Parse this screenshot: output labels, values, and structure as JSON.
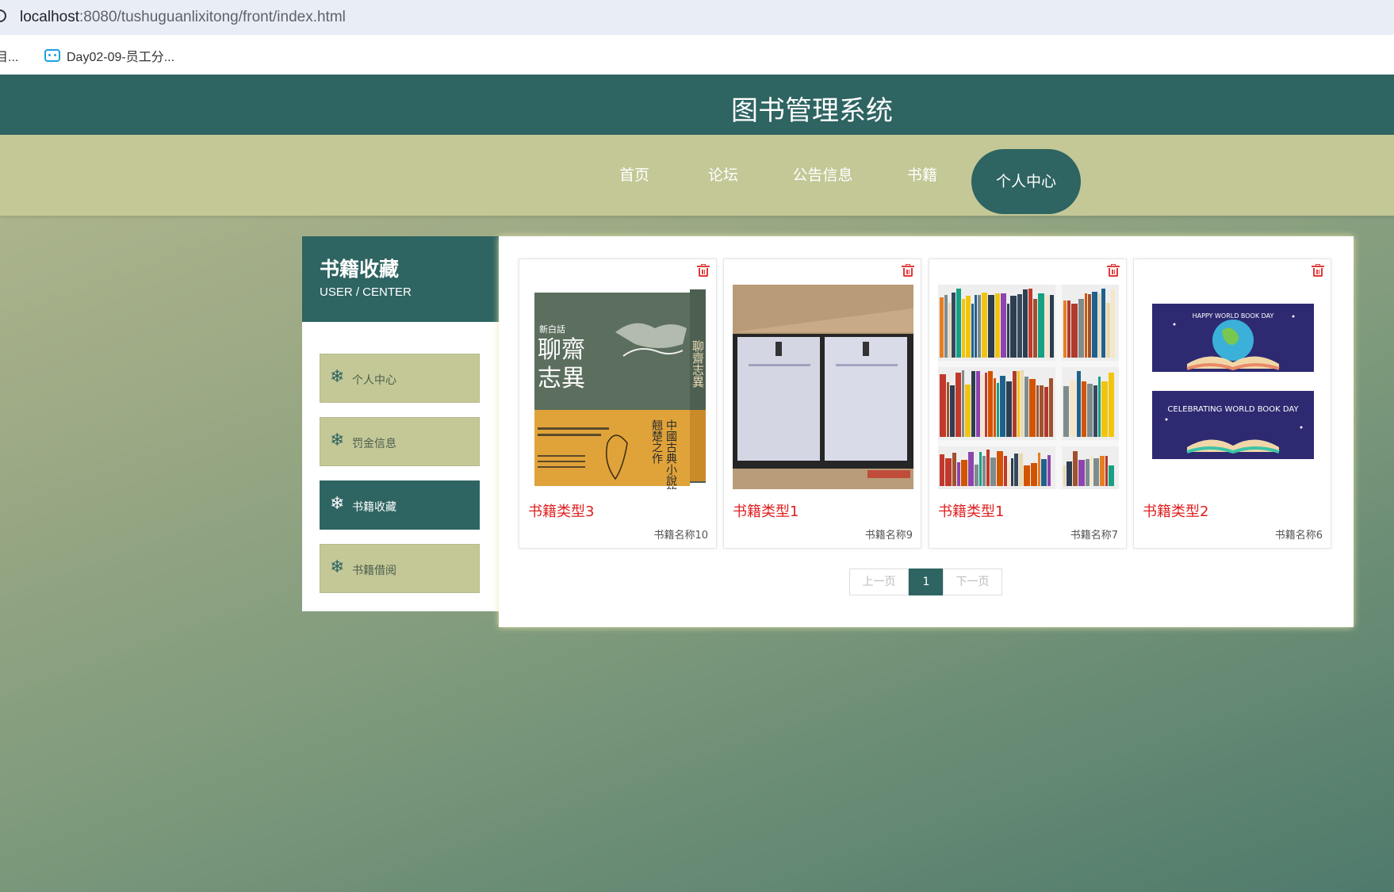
{
  "browser": {
    "url_host": "localhost",
    "url_rest": ":8080/tushuguanlixitong/front/index.html",
    "bookmark_partial": "目...",
    "bookmark_item": "Day02-09-员工分..."
  },
  "header": {
    "title": "图书管理系统"
  },
  "nav": {
    "items": [
      {
        "label": "首页"
      },
      {
        "label": "论坛"
      },
      {
        "label": "公告信息"
      },
      {
        "label": "书籍"
      },
      {
        "label": "个人中心"
      }
    ],
    "active_index": 4
  },
  "sidebar": {
    "title": "书籍收藏",
    "subtitle": "USER / CENTER",
    "items": [
      {
        "label": "个人中心",
        "icon": "snowflake-icon"
      },
      {
        "label": "罚金信息",
        "icon": "snowflake-icon"
      },
      {
        "label": "书籍收藏",
        "icon": "snowflake-icon"
      },
      {
        "label": "书籍借阅",
        "icon": "snowflake-icon"
      }
    ],
    "active_index": 2
  },
  "cards": [
    {
      "type": "书籍类型3",
      "name": "书籍名称10",
      "cover": "liaozhai-book-cover",
      "cover_title": "聊齋志異",
      "cover_sub": "新白話",
      "cover_side": "中國古典小說的翹楚之作"
    },
    {
      "type": "书籍类型1",
      "name": "书籍名称9",
      "cover": "boxed-books-photo"
    },
    {
      "type": "书籍类型1",
      "name": "书籍名称7",
      "cover": "bookshelf-photo"
    },
    {
      "type": "书籍类型2",
      "name": "书籍名称6",
      "cover": "world-book-day-banner",
      "banner_text_1": "HAPPY WORLD BOOK DAY",
      "banner_text_2": "CELEBRATING WORLD BOOK DAY"
    }
  ],
  "pagination": {
    "prev": "上一页",
    "current": "1",
    "next": "下一页"
  },
  "colors": {
    "primary": "#2e6461",
    "nav_bg": "#c4c897",
    "accent_red": "#e02020"
  }
}
